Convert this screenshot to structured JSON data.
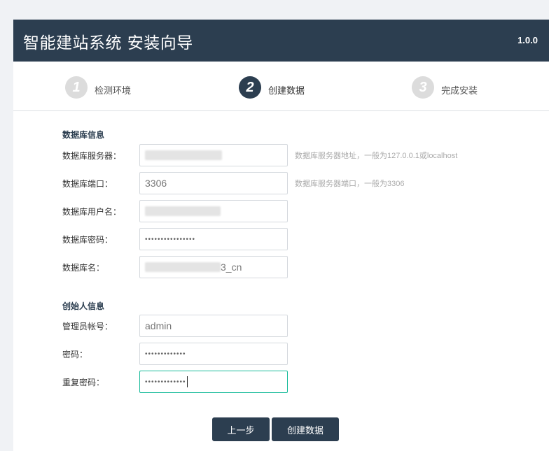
{
  "header": {
    "title": "智能建站系统 安装向导",
    "version": "1.0.0"
  },
  "steps": [
    {
      "number": "1",
      "label": "检测环境",
      "active": false
    },
    {
      "number": "2",
      "label": "创建数据",
      "active": true
    },
    {
      "number": "3",
      "label": "完成安装",
      "active": false
    }
  ],
  "db_section": {
    "title": "数据库信息",
    "server_label": "数据库服务器：",
    "server_hint": "数据库服务器地址，一般为127.0.0.1或localhost",
    "port_label": "数据库端口：",
    "port_value": "3306",
    "port_hint": "数据库服务器端口，一般为3306",
    "user_label": "数据库用户名：",
    "password_label": "数据库密码：",
    "password_mask": "••••••••••••••••",
    "name_label": "数据库名：",
    "name_visible_suffix": "3_cn"
  },
  "admin_section": {
    "title": "创始人信息",
    "account_label": "管理员帐号：",
    "account_value": "admin",
    "password_label": "密码：",
    "password_mask": "•••••••••••••",
    "repeat_label": "重复密码：",
    "repeat_mask": "•••••••••••••"
  },
  "buttons": {
    "prev": "上一步",
    "create": "创建数据"
  },
  "colors": {
    "header_bg": "#2c3e50",
    "focus_border": "#1abc9c"
  }
}
